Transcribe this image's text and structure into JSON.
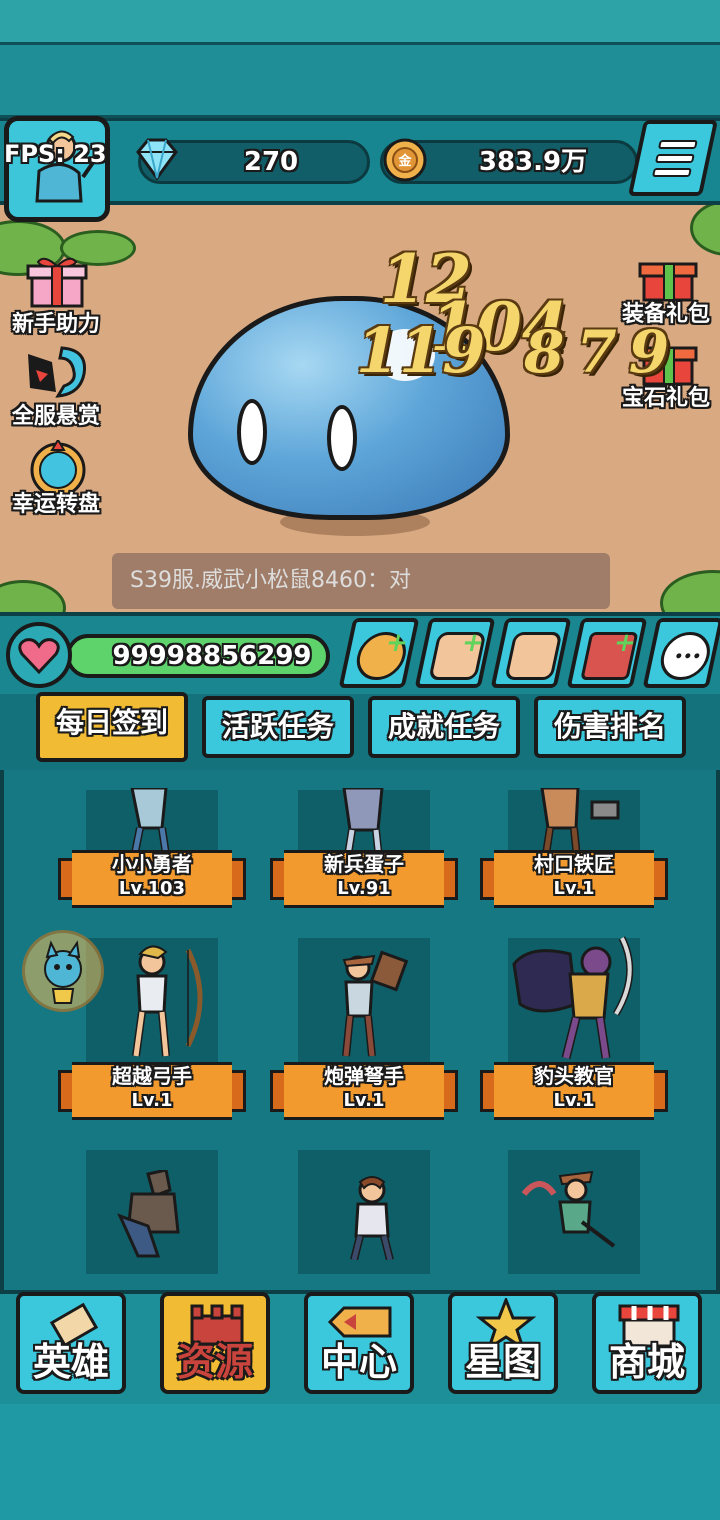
{
  "hud": {
    "fps": "FPS: 23",
    "gems": "270",
    "gold": "383.9万",
    "hp": "99998856299"
  },
  "side_left": [
    {
      "label": "新手助力",
      "icon": "gift-icon"
    },
    {
      "label": "全服悬赏",
      "icon": "bounty-icon"
    },
    {
      "label": "幸运转盘",
      "icon": "wheel-icon"
    }
  ],
  "side_right": [
    {
      "label": "装备礼包",
      "icon": "gift-box-icon"
    },
    {
      "label": "宝石礼包",
      "icon": "gift-box-icon"
    }
  ],
  "damage_numbers": [
    "12",
    "104",
    "119",
    "879"
  ],
  "chat": {
    "message": "S39服.威武小松鼠8460：对"
  },
  "tabs": [
    {
      "label": "每日签到",
      "active": true
    },
    {
      "label": "活跃任务",
      "active": false
    },
    {
      "label": "成就任务",
      "active": false
    },
    {
      "label": "伤害排名",
      "active": false
    }
  ],
  "heroes": [
    {
      "name": "小小勇者",
      "level": "Lv.103"
    },
    {
      "name": "新兵蛋子",
      "level": "Lv.91"
    },
    {
      "name": "村口铁匠",
      "level": "Lv.1"
    },
    {
      "name": "超越弓手",
      "level": "Lv.1"
    },
    {
      "name": "炮弹弩手",
      "level": "Lv.1"
    },
    {
      "name": "豹头教官",
      "level": "Lv.1"
    }
  ],
  "nav": [
    {
      "label": "英雄",
      "active": false
    },
    {
      "label": "资源",
      "active": true
    },
    {
      "label": "中心",
      "active": false
    },
    {
      "label": "星图",
      "active": false
    },
    {
      "label": "商城",
      "active": false
    }
  ],
  "colors": {
    "teal": "#1b7f8a",
    "accent_cyan": "#3cc8dc",
    "active_gold": "#f1bb33",
    "hp_green": "#5ed36b",
    "ribbon_orange": "#f39a2e"
  }
}
